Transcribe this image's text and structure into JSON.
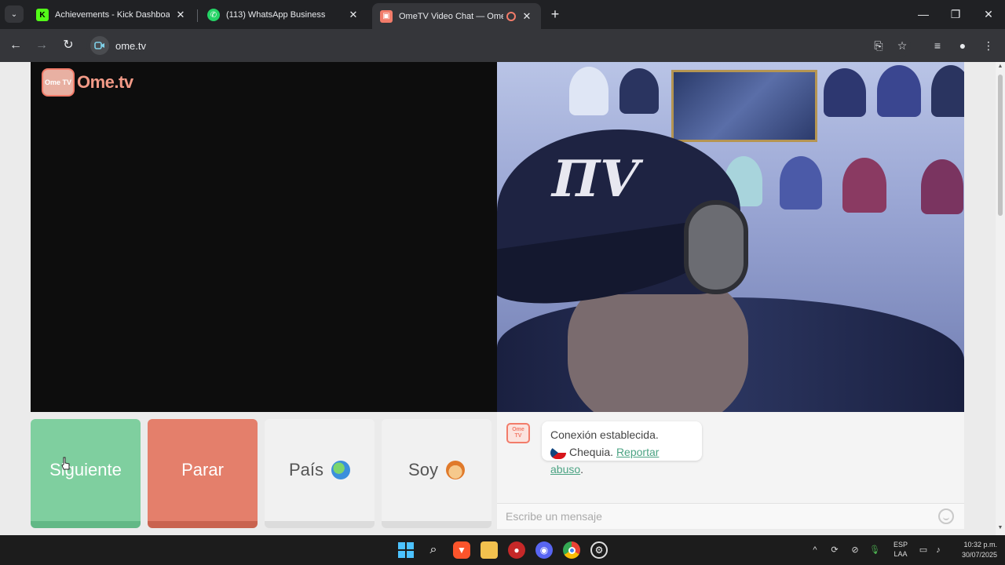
{
  "browser": {
    "tabs": [
      {
        "title": "Achievements - Kick Dashboard",
        "favicon": "kick-icon"
      },
      {
        "title": "(113) WhatsApp Business",
        "favicon": "whatsapp-icon"
      },
      {
        "title": "OmeTV Video Chat — Omegle R",
        "favicon": "ometv-icon"
      }
    ],
    "url": "ome.tv"
  },
  "brand": {
    "logo_tv": "Ome TV",
    "logo_text": "Ome.tv"
  },
  "controls": {
    "next_label": "Siguiente",
    "stop_label": "Parar",
    "country_label": "País",
    "gender_label": "Soy"
  },
  "chat": {
    "logo_text": "Ome TV",
    "status": "Conexión establecida.",
    "country": "Chequia.",
    "report_link": "Reportar abuso",
    "report_suffix": ".",
    "input_placeholder": "Escribe un mensaje"
  },
  "taskbar": {
    "lang_top": "ESP",
    "lang_bottom": "LAA",
    "time": "10:32 p.m.",
    "date": "30/07/2025"
  },
  "colors": {
    "next": "#7fcf9f",
    "stop": "#e47f6b",
    "accent": "#f27c6a",
    "link": "#4ba383"
  }
}
